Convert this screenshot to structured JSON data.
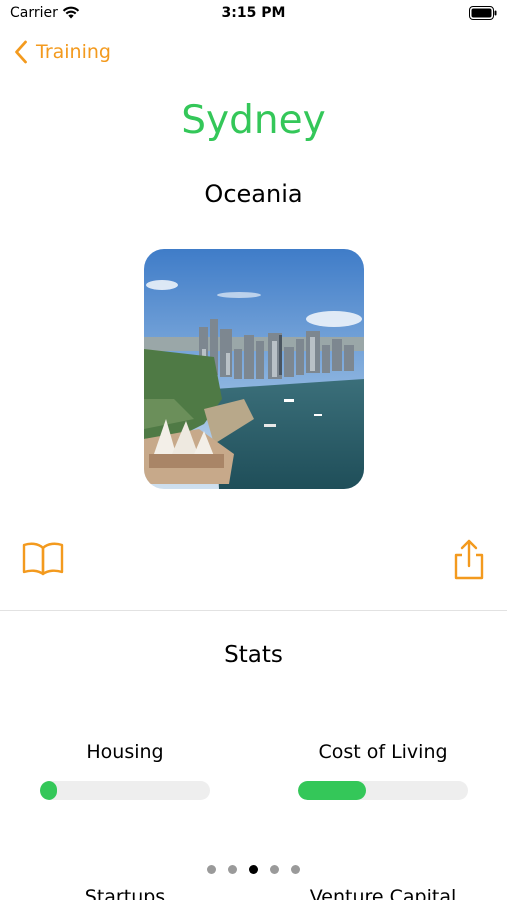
{
  "status_bar": {
    "carrier": "Carrier",
    "time": "3:15 PM",
    "wifi_icon": "wifi-icon",
    "battery_icon": "battery-icon"
  },
  "nav": {
    "back_label": "Training",
    "back_icon": "chevron-left-icon"
  },
  "city": {
    "name": "Sydney",
    "continent": "Oceania",
    "photo": "sydney-harbour-photo"
  },
  "actions": {
    "book_icon": "book-icon",
    "share_icon": "share-icon"
  },
  "stats": {
    "heading": "Stats",
    "items": [
      {
        "label": "Housing",
        "level": 0.06
      },
      {
        "label": "Cost of Living",
        "level": 0.4
      }
    ],
    "next_items": [
      {
        "label": "Startups"
      },
      {
        "label": "Venture Capital"
      }
    ]
  },
  "pager": {
    "count": 5,
    "active_index": 2
  },
  "colors": {
    "accent": "#f39a1e",
    "title_green": "#34c759",
    "progress_fill": "#34c759",
    "progress_track": "#eeeeee"
  }
}
